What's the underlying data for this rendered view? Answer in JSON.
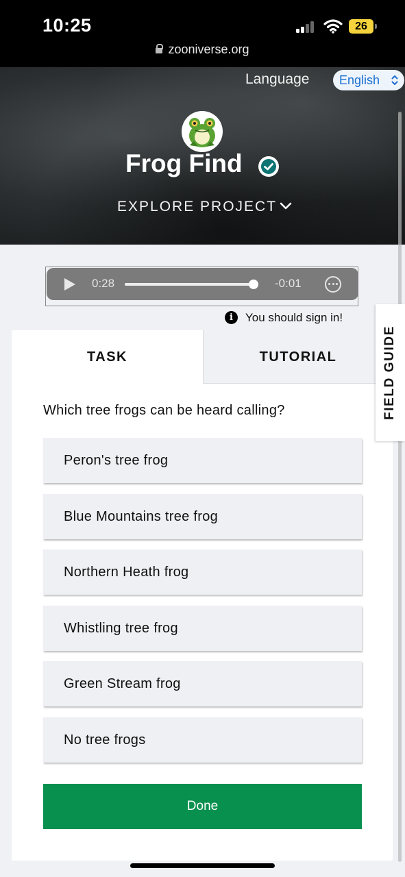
{
  "status_bar": {
    "time": "10:25",
    "battery": "26",
    "url": "zooniverse.org"
  },
  "header": {
    "language_label": "Language",
    "language_value": "English",
    "project_title": "Frog Find",
    "explore_label": "EXPLORE PROJECT"
  },
  "audio_player": {
    "current_time": "0:28",
    "remaining_time": "-0:01",
    "progress_percent": 97
  },
  "notice": {
    "sign_in_text": "You should sign in!"
  },
  "tabs": {
    "task": "TASK",
    "tutorial": "TUTORIAL"
  },
  "task": {
    "question": "Which tree frogs can be heard calling?",
    "answers": [
      "Peron's tree frog",
      "Blue Mountains tree frog",
      "Northern Heath frog",
      "Whistling tree frog",
      "Green Stream frog",
      "No tree frogs"
    ],
    "done_label": "Done"
  },
  "field_guide": {
    "label": "FIELD GUIDE"
  },
  "colors": {
    "done_green": "#08904f",
    "verified_teal": "#0e7474",
    "language_blue": "#1b6fd1"
  }
}
